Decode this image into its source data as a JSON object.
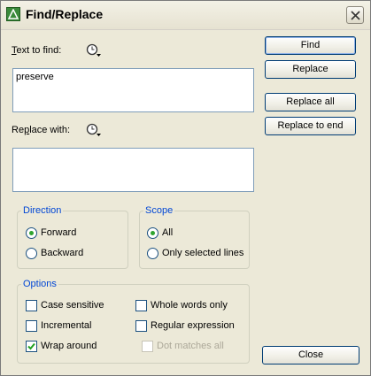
{
  "window": {
    "title": "Find/Replace",
    "close_icon": "close-icon"
  },
  "find": {
    "label_prefix": "",
    "label_key": "T",
    "label_rest": "ext to find:",
    "value": "preserve",
    "history_icon": "history-dropdown-icon"
  },
  "replace": {
    "label_prefix": "Re",
    "label_key": "p",
    "label_rest": "lace with:",
    "value": "",
    "history_icon": "history-dropdown-icon"
  },
  "buttons": {
    "find": "Find",
    "replace": "Replace",
    "replace_all": "Replace all",
    "replace_to_end": "Replace to end",
    "close": "Close"
  },
  "direction": {
    "title": "Direction",
    "forward": "Forward",
    "backward": "Backward",
    "selected": "Forward"
  },
  "scope": {
    "title": "Scope",
    "all": "All",
    "selected_lines": "Only selected lines",
    "selected": "All"
  },
  "options": {
    "title": "Options",
    "case_sensitive": {
      "label": "Case sensitive",
      "checked": false,
      "enabled": true
    },
    "incremental": {
      "label": "Incremental",
      "checked": false,
      "enabled": true
    },
    "wrap_around": {
      "label": "Wrap around",
      "checked": true,
      "enabled": true
    },
    "whole_words": {
      "label": "Whole words only",
      "checked": false,
      "enabled": true
    },
    "regex": {
      "label": "Regular expression",
      "checked": false,
      "enabled": true
    },
    "dot_matches_all": {
      "label": "Dot matches all",
      "checked": false,
      "enabled": false
    }
  },
  "colors": {
    "background": "#ece9d8",
    "group_title": "#0046d5",
    "button_border": "#003c74",
    "field_border": "#7f9db9",
    "radio_dot": "#2fa42f"
  }
}
